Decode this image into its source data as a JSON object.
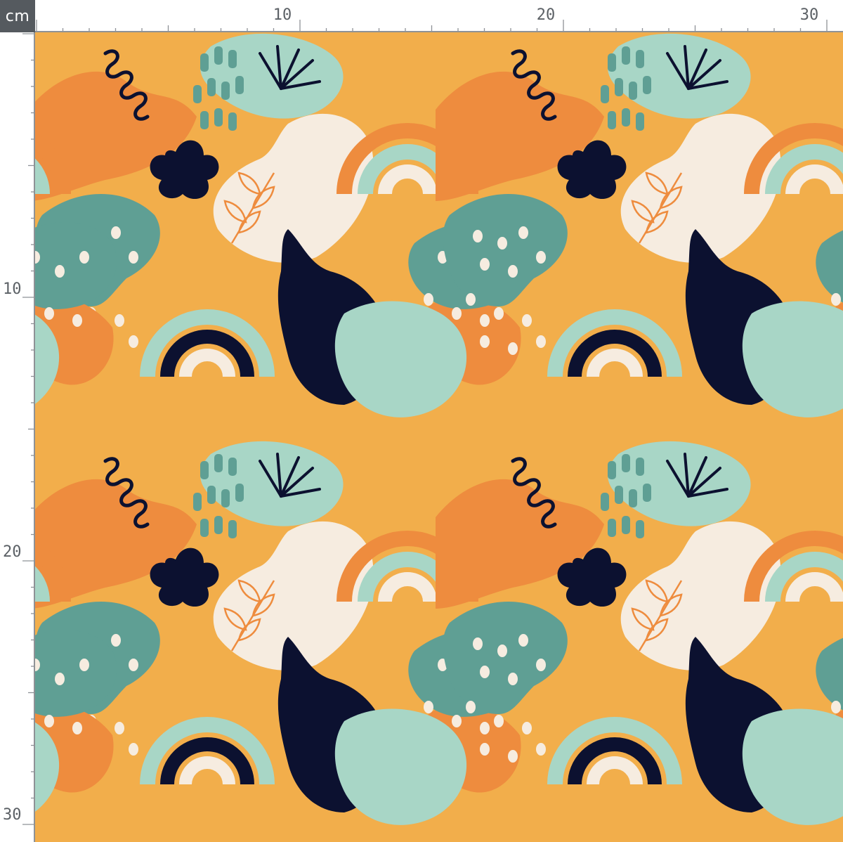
{
  "ruler": {
    "unit": "cm",
    "top_labels": [
      "10",
      "20",
      "30"
    ],
    "left_labels": [
      "10",
      "20",
      "30"
    ]
  },
  "pattern": {
    "colors": {
      "background": "#f2ae4b",
      "orange": "#ee8c3e",
      "teal": "#5f9f94",
      "mint": "#a8d6c6",
      "cream": "#f6ece0",
      "navy": "#0c1130"
    },
    "motifs": [
      "rainbow",
      "flower",
      "squiggle",
      "leaf-sprig",
      "sunburst",
      "dash-marks",
      "dots",
      "blob"
    ]
  }
}
